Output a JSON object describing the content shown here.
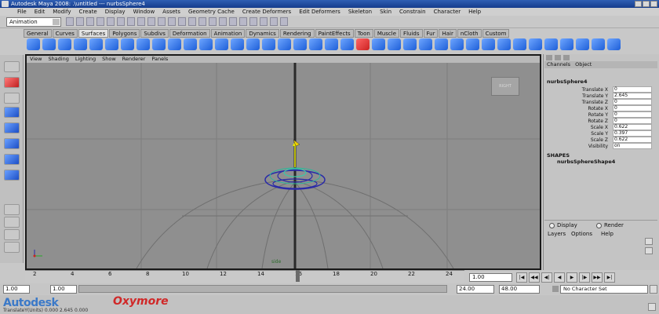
{
  "window": {
    "title": "Autodesk Maya 2008: .\\untitled   ---   nurbsSphere4"
  },
  "menubar": [
    "File",
    "Edit",
    "Modify",
    "Create",
    "Display",
    "Window",
    "Assets",
    "Geometry Cache",
    "Create Deformers",
    "Edit Deformers",
    "Skeleton",
    "Skin",
    "Constrain",
    "Character",
    "Help"
  ],
  "statusline": {
    "mode": "Animation"
  },
  "shelf_tabs": [
    "General",
    "Curves",
    "Surfaces",
    "Polygons",
    "Subdivs",
    "Deformation",
    "Animation",
    "Dynamics",
    "Rendering",
    "PaintEffects",
    "Toon",
    "Muscle",
    "Fluids",
    "Fur",
    "Hair",
    "nCloth",
    "Custom"
  ],
  "shelf_active": "Surfaces",
  "viewport": {
    "menu": [
      "View",
      "Shading",
      "Lighting",
      "Show",
      "Renderer",
      "Panels"
    ],
    "view_cube_label": "RIGHT",
    "camera_label": "side"
  },
  "channel_box": {
    "header": [
      "Channels",
      "Object"
    ],
    "object": "nurbsSphere4",
    "channels": [
      {
        "label": "Translate X",
        "value": "0"
      },
      {
        "label": "Translate Y",
        "value": "2.645"
      },
      {
        "label": "Translate Z",
        "value": "0"
      },
      {
        "label": "Rotate X",
        "value": "0"
      },
      {
        "label": "Rotate Y",
        "value": "0"
      },
      {
        "label": "Rotate Z",
        "value": "0"
      },
      {
        "label": "Scale X",
        "value": "0.622"
      },
      {
        "label": "Scale Y",
        "value": "0.397"
      },
      {
        "label": "Scale Z",
        "value": "0.622"
      },
      {
        "label": "Visibility",
        "value": "on"
      }
    ],
    "shapes_label": "SHAPES",
    "shape_name": "nurbsSphereShape4"
  },
  "layer_editor": {
    "display": "Display",
    "render": "Render",
    "menu": [
      "Layers",
      "Options",
      "Help"
    ]
  },
  "timeline": {
    "ticks": [
      "2",
      "4",
      "6",
      "8",
      "10",
      "12",
      "14",
      "16",
      "18",
      "20",
      "22",
      "24"
    ],
    "current_frame": "1.00",
    "range_start": "1.00",
    "range_start_inner": "1.00",
    "range_end_inner": "24.00",
    "range_end": "48.00",
    "character_set": "No Character Set"
  },
  "playback": [
    "|◀",
    "◀◀",
    "◀|",
    "◀",
    "▶",
    "|▶",
    "▶▶",
    "▶|"
  ],
  "footer": {
    "brand1": "Autodesk",
    "brand2": "Oxymore",
    "helpline": "TranslateY(Units)   0.000      2.645     0.000"
  }
}
